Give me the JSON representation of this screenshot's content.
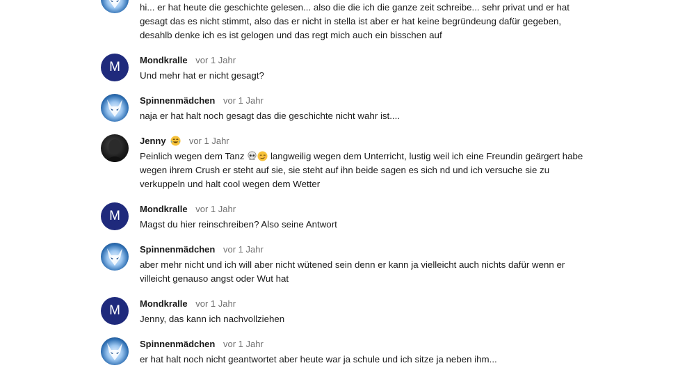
{
  "comments": [
    {
      "author": "",
      "time": "",
      "text": "hi... er hat heute die geschichte gelesen... also die die ich die ganze zeit schreibe... sehr privat und er hat gesagt das es nicht stimmt, also das er nicht in stella ist aber er hat keine begründeung dafür gegeben, desahlb denke ich es ist gelogen und das regt mich auch ein bisschen auf",
      "avatar": "wolf-avatar"
    },
    {
      "author": "Mondkralle",
      "time": "vor 1 Jahr",
      "text": "Und mehr hat er nicht gesagt?",
      "avatar_letter": "M"
    },
    {
      "author": "Spinnenmädchen",
      "time": "vor 1 Jahr",
      "text": "naja er hat halt noch gesagt das die geschichte nicht wahr ist....",
      "avatar": "wolf-avatar"
    },
    {
      "author": "Jenny",
      "author_emoji": "laughing-tears-emoji",
      "time": "vor 1 Jahr",
      "text_before": "Peinlich wegen dem Tanz ",
      "text_emojis": [
        "skull-emoji",
        "smirk-emoji"
      ],
      "text_after": " langweilig wegen dem Unterricht, lustig weil ich eine Freundin geärgert habe wegen ihrem Crush er steht auf sie, sie steht auf ihn beide sagen es sich nd und ich versuche sie zu verkuppeln und halt cool wegen dem Wetter",
      "avatar": "dark-avatar"
    },
    {
      "author": "Mondkralle",
      "time": "vor 1 Jahr",
      "text": "Magst du hier reinschreiben? Also seine Antwort",
      "avatar_letter": "M"
    },
    {
      "author": "Spinnenmädchen",
      "time": "vor 1 Jahr",
      "text": "aber mehr nicht und ich will aber nicht wütened sein denn er kann ja vielleicht auch nichts dafür wenn er villeicht genauso angst oder Wut hat",
      "avatar": "wolf-avatar"
    },
    {
      "author": "Mondkralle",
      "time": "vor 1 Jahr",
      "text": "Jenny, das kann ich nachvollziehen",
      "avatar_letter": "M"
    },
    {
      "author": "Spinnenmädchen",
      "time": "vor 1 Jahr",
      "text": "er hat halt noch nicht geantwortet aber heute war ja schule und ich sitze ja neben ihm...",
      "avatar": "wolf-avatar"
    }
  ],
  "colors": {
    "letter_avatar_bg": "#1f2a7c",
    "time_text": "#707070",
    "body_text": "#1a1a1a"
  }
}
